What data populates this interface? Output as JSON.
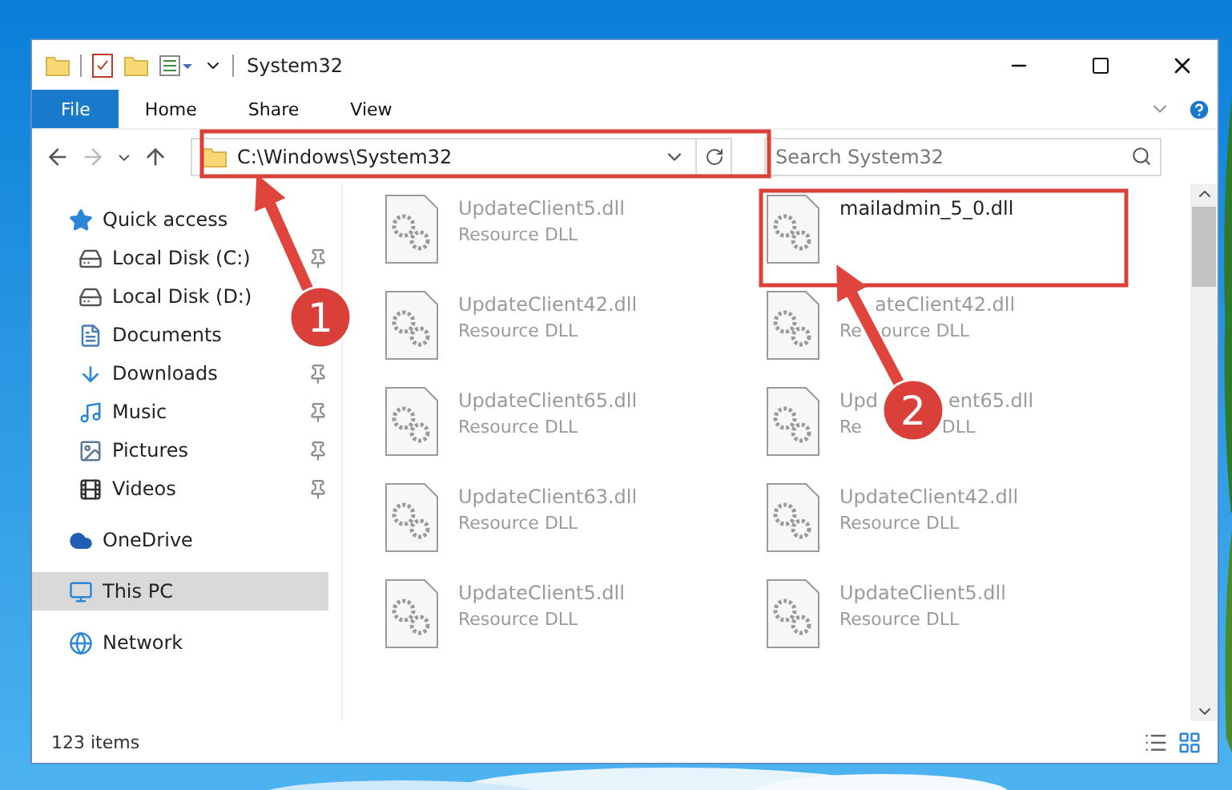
{
  "window": {
    "title": "System32"
  },
  "ribbon": {
    "tabs": [
      {
        "label": "File",
        "selected": true
      },
      {
        "label": "Home",
        "selected": false
      },
      {
        "label": "Share",
        "selected": false
      },
      {
        "label": "View",
        "selected": false
      }
    ]
  },
  "address_bar": {
    "path": "C:\\Windows\\System32"
  },
  "search": {
    "placeholder": "Search System32"
  },
  "sidebar": {
    "items": [
      {
        "label": "Quick access",
        "selected": false,
        "children": [
          {
            "label": "Local Disk (C:)",
            "pinned": true
          },
          {
            "label": "Local Disk (D:)",
            "pinned": false
          },
          {
            "label": "Documents",
            "pinned": false
          },
          {
            "label": "Downloads",
            "pinned": true
          },
          {
            "label": "Music",
            "pinned": true
          },
          {
            "label": "Pictures",
            "pinned": true
          },
          {
            "label": "Videos",
            "pinned": true
          }
        ]
      },
      {
        "label": "OneDrive",
        "selected": false
      },
      {
        "label": "This PC",
        "selected": true
      },
      {
        "label": "Network",
        "selected": false
      }
    ]
  },
  "files": [
    {
      "kind": "plain",
      "name": "UpdateClient5.dll",
      "type": "Resource DLL",
      "blurred": true
    },
    {
      "kind": "plain",
      "name": "mailadmin_5_0.dll",
      "blurred": false
    },
    {
      "kind": "plain",
      "name": "UpdateClient42.dll",
      "type": "Resource DLL",
      "blurred": true
    },
    {
      "kind": "split",
      "name_parts": [
        "ateClient42.dll"
      ],
      "type_parts": [
        "Re",
        "ource DLL"
      ],
      "blurred": true
    },
    {
      "kind": "plain",
      "name": "UpdateClient65.dll",
      "type": "Resource DLL",
      "blurred": true
    },
    {
      "kind": "split",
      "name_parts": [
        "Upd",
        "ent65.dll"
      ],
      "type_parts": [
        "Re",
        "DLL"
      ],
      "blurred": true
    },
    {
      "kind": "plain",
      "name": "UpdateClient63.dll",
      "type": "Resource DLL",
      "blurred": true
    },
    {
      "kind": "plain",
      "name": "UpdateClient42.dll",
      "type": "Resource DLL",
      "blurred": true
    },
    {
      "kind": "plain",
      "name": "UpdateClient5.dll",
      "type": "Resource DLL",
      "blurred": true
    },
    {
      "kind": "plain",
      "name": "UpdateClient5.dll",
      "type": "Resource DLL",
      "blurred": true
    }
  ],
  "status_bar": {
    "items": "123 items"
  },
  "annotations": [
    {
      "number": "1"
    },
    {
      "number": "2"
    }
  ]
}
